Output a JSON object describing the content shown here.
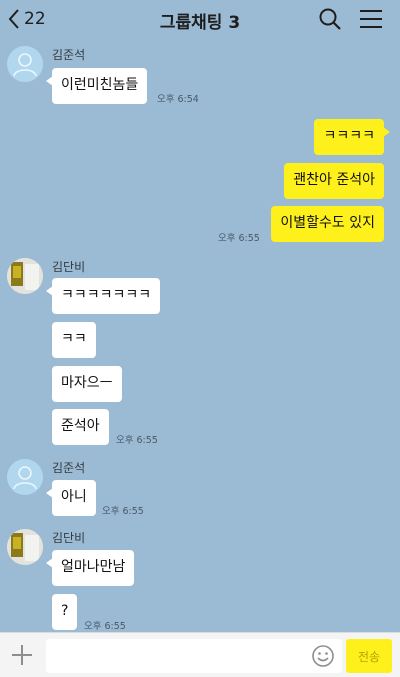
{
  "header": {
    "back_count": "22",
    "title": "그룹채팅 3"
  },
  "senders": {
    "a": "김준석",
    "b": "김단비"
  },
  "messages": [
    {
      "text": "이런미친놈들",
      "time": "오후 6:54"
    },
    {
      "text": "ㅋㅋㅋㅋ"
    },
    {
      "text": "괜찬아 준석아"
    },
    {
      "text": "이별할수도 있지",
      "time": "오후 6:55"
    },
    {
      "text": "ㅋㅋㅋㅋㅋㅋㅋ"
    },
    {
      "text": "ㅋㅋ"
    },
    {
      "text": "마자으ㅡ"
    },
    {
      "text": "준석아",
      "time": "오후 6:55"
    },
    {
      "text": "아니",
      "time": "오후 6:55"
    },
    {
      "text": "얼마나만남"
    },
    {
      "text": "?",
      "time": "오후 6:55"
    }
  ],
  "input": {
    "value": "",
    "placeholder": "",
    "send_label": "전송"
  },
  "colors": {
    "chat_background": "#9bbbd4",
    "my_bubble": "#fef01b",
    "their_bubble": "#ffffff"
  },
  "icons": [
    "back-chevron-icon",
    "search-icon",
    "menu-icon",
    "default-avatar-icon",
    "photo-avatar",
    "plus-icon",
    "emoji-icon"
  ]
}
